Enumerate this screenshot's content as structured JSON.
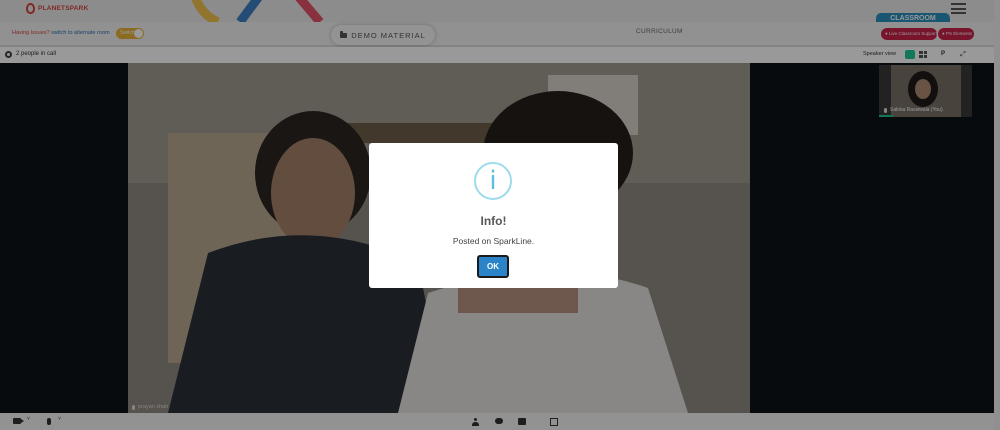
{
  "brand": {
    "logo_text": "PLANETSPARK"
  },
  "header": {
    "classroom_tab": "CLASSROOM"
  },
  "toolbar": {
    "issues_prefix": "Having Issues?",
    "issues_text": " switch to alternate room",
    "toggle_label": "Switch",
    "demo_material": "DEMO MATERIAL",
    "curriculum": "CURRICULUM",
    "support_pill": "Live Classroom Support",
    "elements_pill": "PS Elements"
  },
  "call": {
    "people_in_call": "2 people in call",
    "speaker_view": "Speaker view",
    "p_button": "P"
  },
  "video": {
    "main_participant": "prayan shah",
    "self_participant": "Sakina Rassiwala (You)"
  },
  "modal": {
    "icon_glyph": "i",
    "title": "Info!",
    "message": "Posted on SparkLine.",
    "ok_label": "OK"
  },
  "colors": {
    "accent_teal": "#20c997",
    "classroom_blue": "#2a8fbf",
    "pill_red": "#c9224a",
    "ok_blue": "#2b84c7",
    "info_cyan": "#5bc0de"
  }
}
